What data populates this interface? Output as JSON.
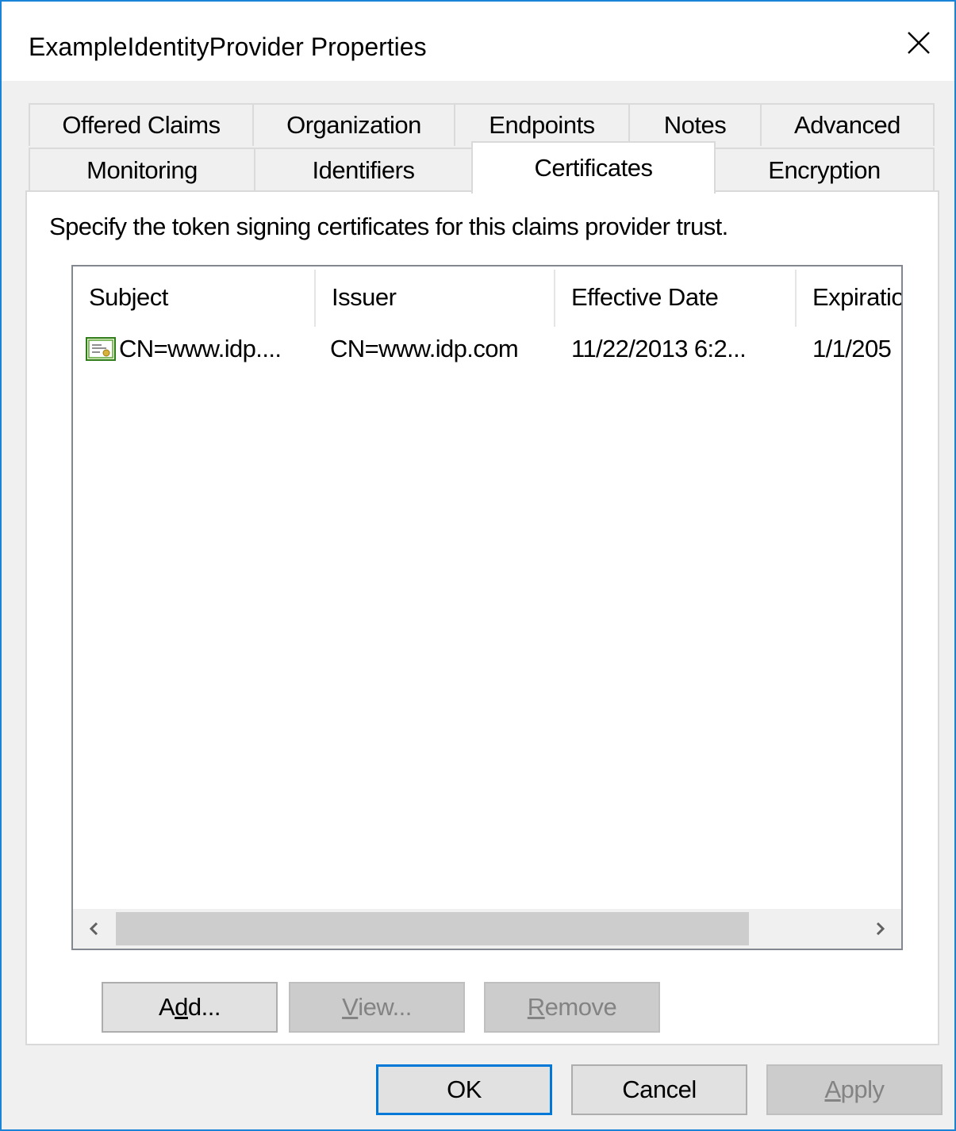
{
  "window": {
    "title": "ExampleIdentityProvider Properties"
  },
  "tabs": {
    "row_top": [
      "Offered Claims",
      "Organization",
      "Endpoints",
      "Notes",
      "Advanced"
    ],
    "row_bottom": [
      "Monitoring",
      "Identifiers",
      "Certificates",
      "Encryption"
    ],
    "active": "Certificates"
  },
  "panel": {
    "description": "Specify the token signing certificates for this claims provider trust."
  },
  "certificates_table": {
    "columns": [
      "Subject",
      "Issuer",
      "Effective Date",
      "Expiratio"
    ],
    "rows": [
      {
        "icon": "certificate-icon",
        "subject": "CN=www.idp....",
        "issuer": "CN=www.idp.com",
        "effective_date": "11/22/2013 6:2...",
        "expiration": "1/1/205"
      }
    ]
  },
  "panel_buttons": {
    "add": {
      "pre": "A",
      "mn": "d",
      "post": "d...",
      "enabled": true
    },
    "view": {
      "pre": "",
      "mn": "V",
      "post": "iew...",
      "enabled": false
    },
    "remove": {
      "pre": "",
      "mn": "R",
      "post": "emove",
      "enabled": false
    }
  },
  "dialog_buttons": {
    "ok": "OK",
    "cancel": "Cancel",
    "apply": {
      "pre": "",
      "mn": "A",
      "post": "pply",
      "enabled": false
    }
  },
  "colors": {
    "window_border": "#1883d7",
    "default_button_border": "#0078d7",
    "disabled_text": "#838383"
  }
}
